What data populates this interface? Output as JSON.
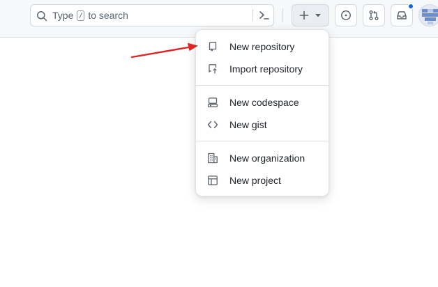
{
  "search": {
    "text_before": "Type",
    "key": "/",
    "text_after": "to search"
  },
  "menu": {
    "items": [
      {
        "label": "New repository",
        "icon": "repo-icon"
      },
      {
        "label": "Import repository",
        "icon": "repo-push-icon"
      },
      {
        "label": "New codespace",
        "icon": "codespaces-icon"
      },
      {
        "label": "New gist",
        "icon": "code-icon"
      },
      {
        "label": "New organization",
        "icon": "organization-icon"
      },
      {
        "label": "New project",
        "icon": "table-icon"
      }
    ]
  },
  "colors": {
    "header_bg": "#f6f8fa",
    "accent_dot": "#0969da",
    "annotation_arrow": "#e02424"
  }
}
